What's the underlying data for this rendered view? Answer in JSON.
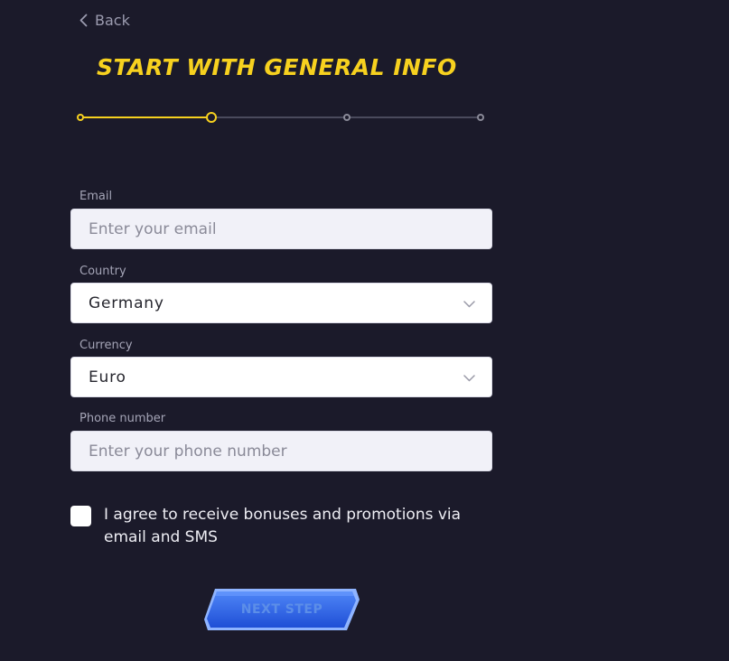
{
  "nav": {
    "back_label": "Back"
  },
  "header": {
    "title": "START WITH GENERAL INFO"
  },
  "stepper": {
    "total_steps": 4,
    "current_step": 2
  },
  "form": {
    "email": {
      "label": "Email",
      "placeholder": "Enter your email",
      "value": ""
    },
    "country": {
      "label": "Country",
      "value": "Germany"
    },
    "currency": {
      "label": "Currency",
      "value": "Euro"
    },
    "phone": {
      "label": "Phone number",
      "placeholder": "Enter your phone number",
      "value": ""
    },
    "consent": {
      "checked": false,
      "label": "I agree to receive bonuses and promotions via email and SMS"
    }
  },
  "actions": {
    "next_label": "NEXT STEP"
  },
  "colors": {
    "background": "#1b1a2a",
    "accent": "#f7d11f",
    "button": "#2f63e6",
    "button_label": "#5c8ee8"
  },
  "icons": [
    "chevron-left-icon",
    "chevron-down-icon"
  ]
}
